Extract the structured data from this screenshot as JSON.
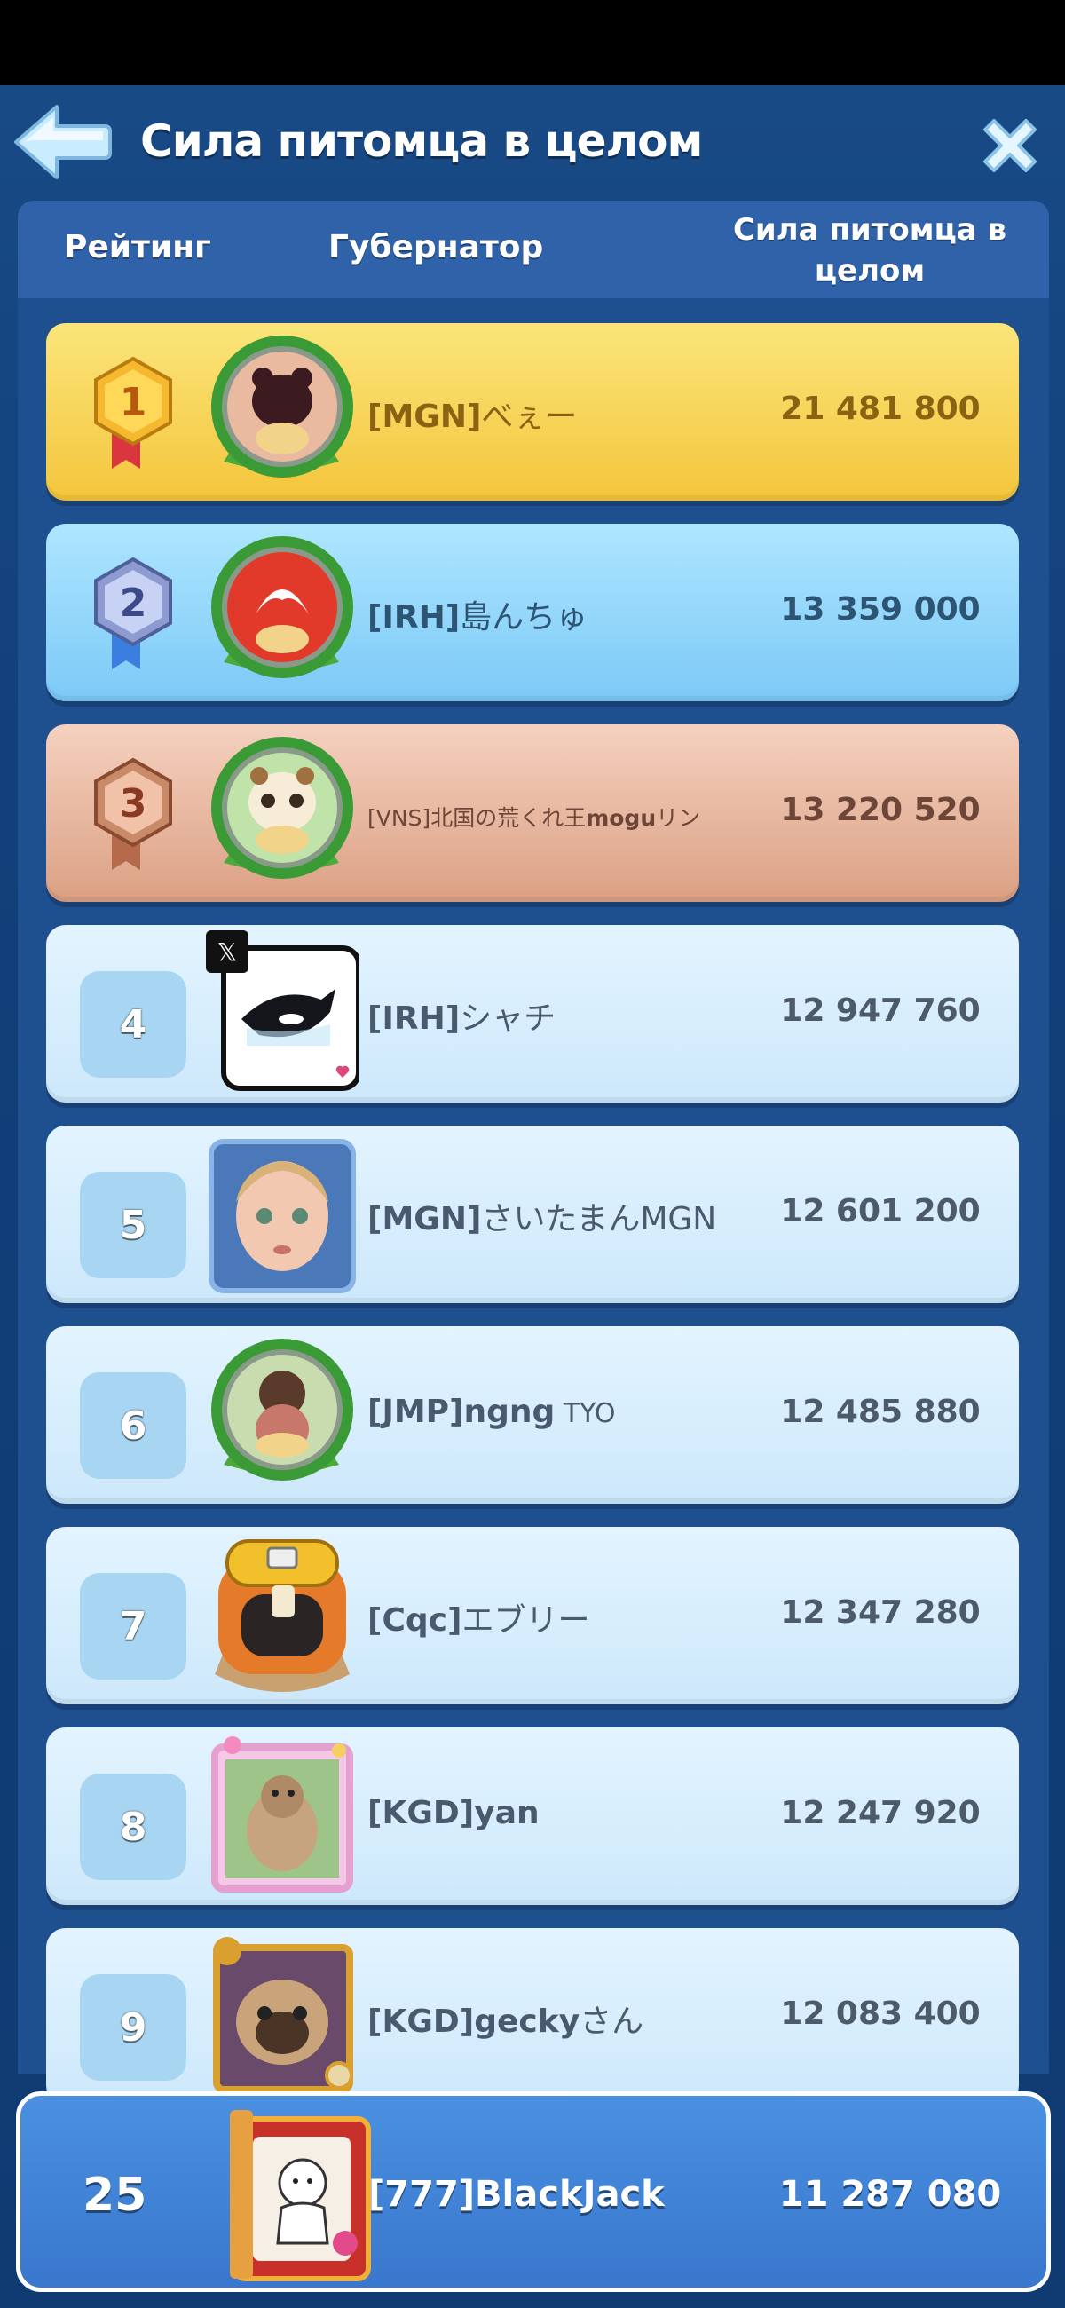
{
  "window": {
    "title": "Сила питомца в целом",
    "back_icon": "arrow-left-icon",
    "close_icon": "close-icon"
  },
  "columns": {
    "rank": "Рейтинг",
    "governor": "Губернатор",
    "power": "Сила питомца в целом"
  },
  "colors": {
    "gold": "#f4c53c",
    "silver": "#7cc9f7",
    "bronze": "#dba083",
    "default_row": "#d6edfc",
    "my_row": "#3f80d4"
  },
  "rankings": [
    {
      "rank": "1",
      "tag": "[MGN]",
      "name": "べぇー",
      "power": "21 481 800",
      "medal": "gold-medal-icon",
      "avatar": "bear-pet-avatar"
    },
    {
      "rank": "2",
      "tag": "[IRH]",
      "name": "島んちゅ",
      "power": "13 359 000",
      "medal": "silver-medal-icon",
      "avatar": "emblem-pet-avatar"
    },
    {
      "rank": "3",
      "tag": "[VNS]",
      "name": "北国の荒くれ王",
      "name_bold": "mogu",
      "name_tail": "リン",
      "power": "13 220 520",
      "medal": "bronze-medal-icon",
      "avatar": "panda-pet-avatar"
    },
    {
      "rank": "4",
      "tag": "[IRH]",
      "name": "シャチ",
      "power": "12 947 760",
      "avatar": "orca-avatar"
    },
    {
      "rank": "5",
      "tag": "[MGN]",
      "name": "さいたまんMGN",
      "power": "12 601 200",
      "avatar": "doll-avatar"
    },
    {
      "rank": "6",
      "tag": "[JMP]",
      "name": "ngng",
      "name_tail": " TYO",
      "power": "12 485 880",
      "avatar": "girl-pet-avatar"
    },
    {
      "rank": "7",
      "tag": "[Cqc]",
      "name": "エブリー",
      "power": "12 347 280",
      "avatar": "miner-avatar"
    },
    {
      "rank": "8",
      "tag": "[KGD]",
      "name": "yan",
      "power": "12 247 920",
      "avatar": "chipmunk-avatar"
    },
    {
      "rank": "9",
      "tag": "[KGD]",
      "name": "gecky",
      "name_tail": "さん",
      "power": "12 083 400",
      "avatar": "pug-avatar"
    }
  ],
  "my_entry": {
    "rank": "25",
    "name": "[777]BlackJack",
    "power": "11 287 080",
    "avatar": "ghost-avatar"
  }
}
